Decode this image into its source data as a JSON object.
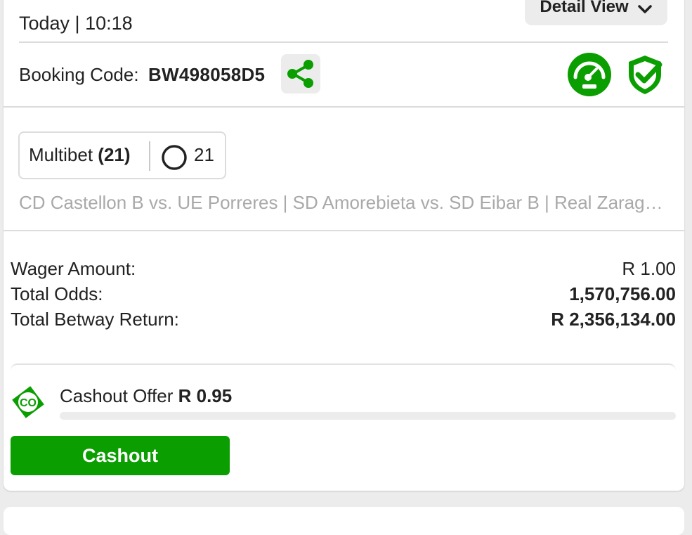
{
  "header": {
    "date_time": "Today | 10:18",
    "detail_view_label": "Detail View"
  },
  "booking": {
    "label": "Booking Code:",
    "code": "BW498058D5"
  },
  "icons": {
    "share": "share-icon",
    "speedometer": "speedometer-icon",
    "shield_check": "shield-check-icon",
    "ring": "ring-icon",
    "cashout_logo": "cashout-logo-icon",
    "chevron": "chevron-down-icon"
  },
  "multibet": {
    "label": "Multibet",
    "count_in_label": "(21)",
    "count": "21"
  },
  "events_summary": "CD Castellon B vs. UE Porreres | SD Amorebieta vs. SD Eibar B | Real Zaragoza",
  "summary": {
    "wager_label": "Wager Amount:",
    "wager_value": "R 1.00",
    "odds_label": "Total Odds:",
    "odds_value": "1,570,756.00",
    "return_label": "Total Betway Return:",
    "return_value": "R 2,356,134.00"
  },
  "cashout": {
    "offer_label": "Cashout Offer",
    "offer_value": "R 0.95",
    "progress_fraction": 0,
    "button_label": "Cashout"
  },
  "colors": {
    "brand_green": "#0a9e01",
    "text": "#222222",
    "muted_text": "#a9a9a9",
    "panel_grey": "#ececec"
  }
}
